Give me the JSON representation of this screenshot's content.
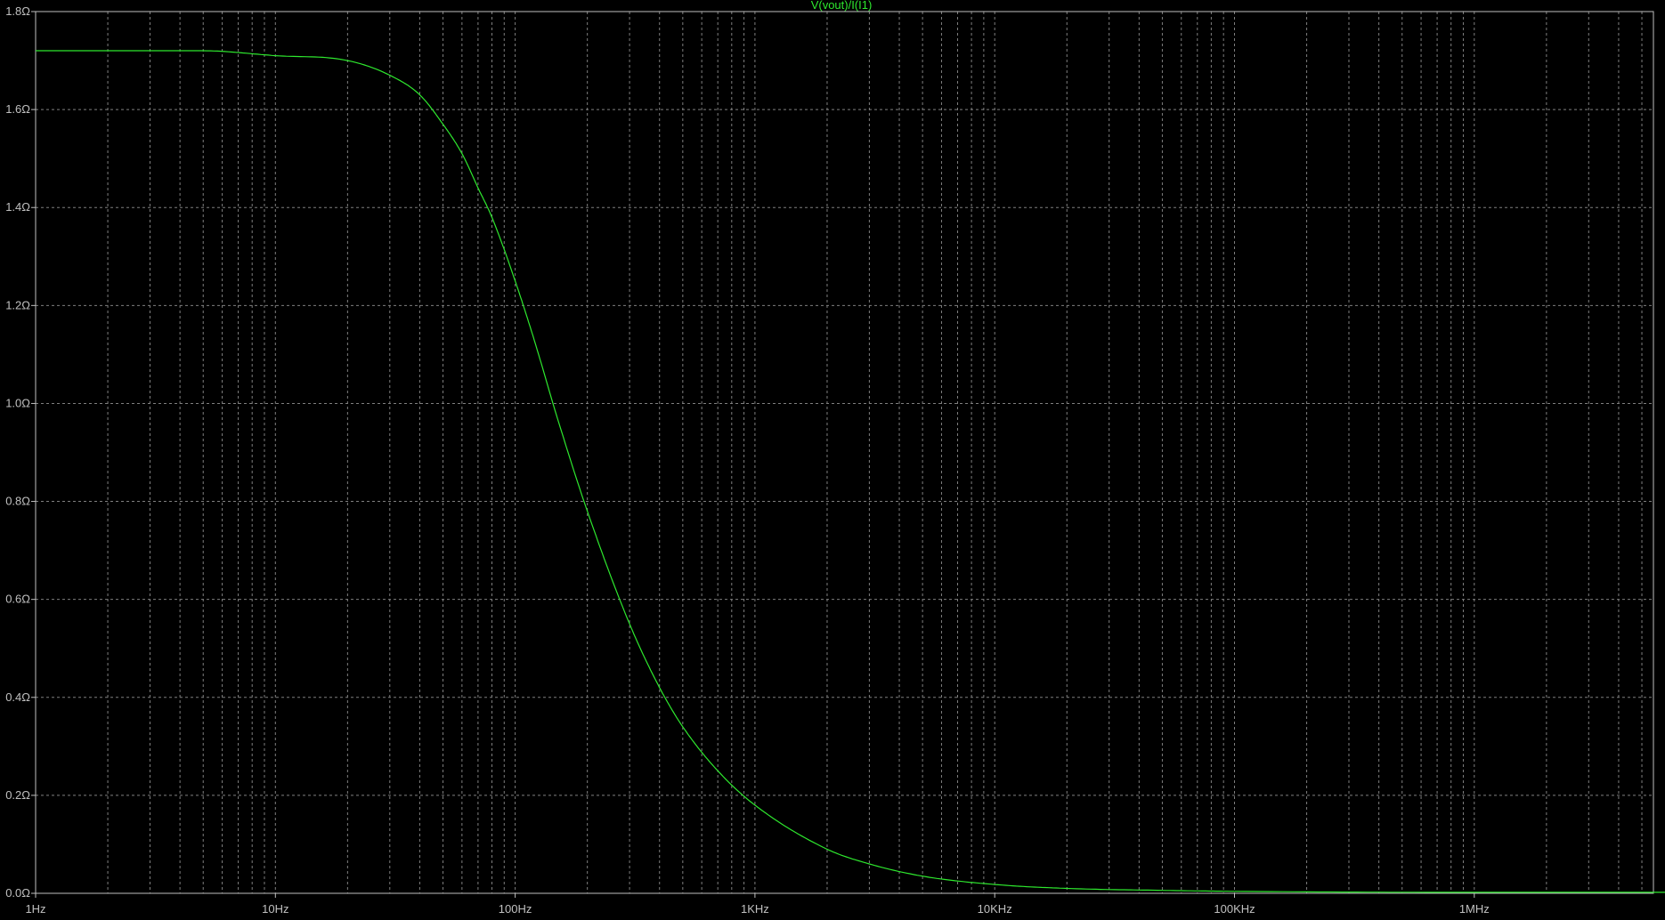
{
  "chart_data": {
    "type": "line",
    "title": "V(vout)/I(I1)",
    "x_scale": "log",
    "x_range_hz": [
      1,
      7000000
    ],
    "ylim": [
      0,
      1.8
    ],
    "x_tick_labels": [
      {
        "value": 1,
        "label": "1Hz"
      },
      {
        "value": 10,
        "label": "10Hz"
      },
      {
        "value": 100,
        "label": "100Hz"
      },
      {
        "value": 1000,
        "label": "1KHz"
      },
      {
        "value": 10000,
        "label": "10KHz"
      },
      {
        "value": 100000,
        "label": "100KHz"
      },
      {
        "value": 1000000,
        "label": "1MHz"
      }
    ],
    "y_tick_labels": [
      {
        "value": 0.0,
        "label": "0.0Ω"
      },
      {
        "value": 0.2,
        "label": "0.2Ω"
      },
      {
        "value": 0.4,
        "label": "0.4Ω"
      },
      {
        "value": 0.6,
        "label": "0.6Ω"
      },
      {
        "value": 0.8,
        "label": "0.8Ω"
      },
      {
        "value": 1.0,
        "label": "1.0Ω"
      },
      {
        "value": 1.2,
        "label": "1.2Ω"
      },
      {
        "value": 1.4,
        "label": "1.4Ω"
      },
      {
        "value": 1.6,
        "label": "1.6Ω"
      },
      {
        "value": 1.8,
        "label": "1.8Ω"
      }
    ],
    "grid": true,
    "colors": {
      "background": "#000000",
      "trace": "#2ee82e",
      "title": "#2ee82e",
      "grid": "#7f7f7f",
      "frame": "#c0c0c0",
      "tick_text": "#c0c0c0"
    },
    "series": [
      {
        "name": "V(vout)/I(I1)",
        "x": [
          1,
          2,
          5,
          10,
          20,
          30,
          40,
          50,
          60,
          70,
          80,
          100,
          120,
          150,
          200,
          300,
          400,
          500,
          700,
          1000,
          2000,
          3000,
          5000,
          10000,
          20000,
          50000,
          100000,
          1000000,
          7000000
        ],
        "y": [
          1.72,
          1.72,
          1.72,
          1.71,
          1.7,
          1.67,
          1.63,
          1.57,
          1.51,
          1.44,
          1.38,
          1.25,
          1.13,
          0.97,
          0.78,
          0.55,
          0.42,
          0.34,
          0.25,
          0.18,
          0.09,
          0.06,
          0.035,
          0.018,
          0.01,
          0.006,
          0.004,
          0.002,
          0.002
        ]
      }
    ]
  }
}
